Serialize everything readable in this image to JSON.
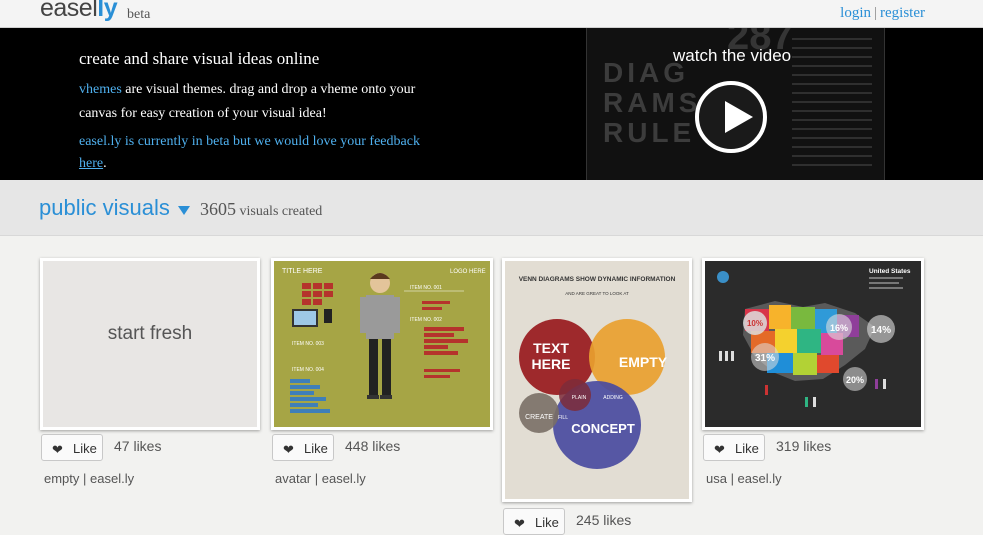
{
  "header": {
    "logo_prefix": "easel",
    "logo_suffix": "ly",
    "beta": "beta",
    "login": "login",
    "separator": "|",
    "register": "register"
  },
  "hero": {
    "title": "create and share visual ideas online",
    "vhemes_link": "vhemes",
    "description": " are visual themes. drag and drop a vheme onto your canvas for easy creation of your visual idea!",
    "beta_note": "easel.ly is currently in beta but we would love your feedback",
    "here_link": "here",
    "period": ".",
    "video_label": "watch the video",
    "video_bg_text": "DIAG RAMS RULE",
    "video_bg_number": "287"
  },
  "section": {
    "title": "public visuals",
    "count": "3605",
    "count_label": " visuals created"
  },
  "cards": [
    {
      "thumb_text": "start fresh",
      "like_label": "Like",
      "likes": "47 likes",
      "caption": "empty | easel.ly"
    },
    {
      "thumb_title": "TITLE HERE",
      "thumb_logo": "LOGO HERE",
      "item1": "ITEM NO. 001",
      "item2": "ITEM NO. 002",
      "item3": "ITEM NO. 003",
      "item4": "ITEM NO. 004",
      "like_label": "Like",
      "likes": "448 likes",
      "caption": "avatar | easel.ly"
    },
    {
      "thumb_title": "VENN DIAGRAMS SHOW DYNAMIC INFORMATION",
      "thumb_sub": "AND ARE GREAT TO LOOK AT",
      "c_text": "TEXT",
      "c_here": "HERE",
      "c_empty": "EMPTY",
      "c_concept": "CONCEPT",
      "c_create": "CREATE",
      "c_fill": "FILL",
      "c_plain": "PLAIN",
      "c_adding": "ADDING",
      "like_label": "Like",
      "likes": "245 likes"
    },
    {
      "thumb_title": "United States",
      "p10": "10%",
      "p16": "16%",
      "p14": "14%",
      "p31": "31%",
      "p20": "20%",
      "like_label": "Like",
      "likes": "319 likes",
      "caption": "usa | easel.ly"
    }
  ]
}
